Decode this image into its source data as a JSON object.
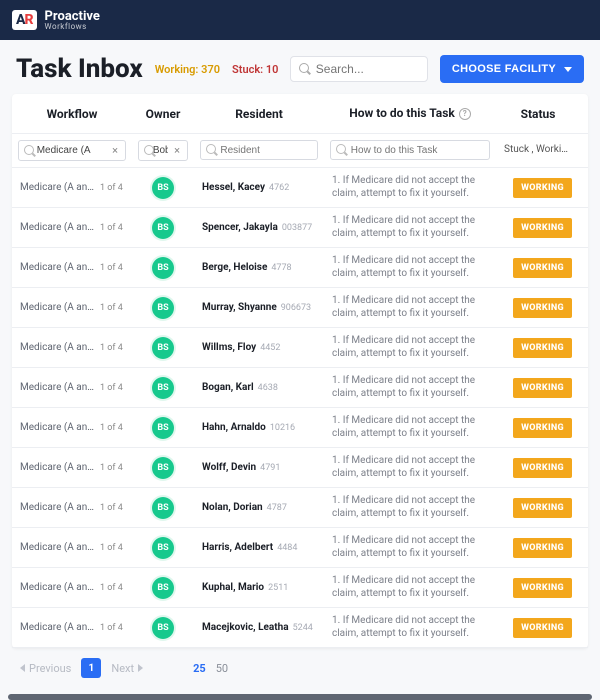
{
  "brand": {
    "badge_a": "A",
    "badge_r": "R",
    "name": "Proactive",
    "sub": "Workflows"
  },
  "header": {
    "title": "Task Inbox",
    "working_label": "Working:",
    "working_count": "370",
    "stuck_label": "Stuck:",
    "stuck_count": "10",
    "search_placeholder": "Search...",
    "facility_btn": "CHOOSE FACILITY"
  },
  "cols": {
    "workflow": "Workflow",
    "owner": "Owner",
    "resident": "Resident",
    "howto": "How to do this Task",
    "status": "Status"
  },
  "filters": {
    "workflow_value": "Medicare (A",
    "owner_value": "Bob Sta",
    "resident_placeholder": "Resident",
    "howto_placeholder": "How to do this Task",
    "status_value": "Stuck , Working"
  },
  "howto_text": "1. If Medicare did not accept the claim, attempt to fix it yourself.",
  "workflow_text": "Medicare (A and B) A...",
  "progress_text": "1 of 4",
  "owner_initials": "BS",
  "status_badge": "WORKING",
  "rows": [
    {
      "name": "Hessel, Kacey",
      "id": "4762"
    },
    {
      "name": "Spencer, Jakayla",
      "id": "003877"
    },
    {
      "name": "Berge, Heloise",
      "id": "4778"
    },
    {
      "name": "Murray, Shyanne",
      "id": "906673"
    },
    {
      "name": "Willms, Floy",
      "id": "4452"
    },
    {
      "name": "Bogan, Karl",
      "id": "4638"
    },
    {
      "name": "Hahn, Arnaldo",
      "id": "10216"
    },
    {
      "name": "Wolff, Devin",
      "id": "4791"
    },
    {
      "name": "Nolan, Dorian",
      "id": "4787"
    },
    {
      "name": "Harris, Adelbert",
      "id": "4484"
    },
    {
      "name": "Kuphal, Mario",
      "id": "2511"
    },
    {
      "name": "Macejkovic, Leatha",
      "id": "5244"
    }
  ],
  "pager": {
    "prev": "Previous",
    "next": "Next",
    "page": "1",
    "size25": "25",
    "size50": "50"
  }
}
